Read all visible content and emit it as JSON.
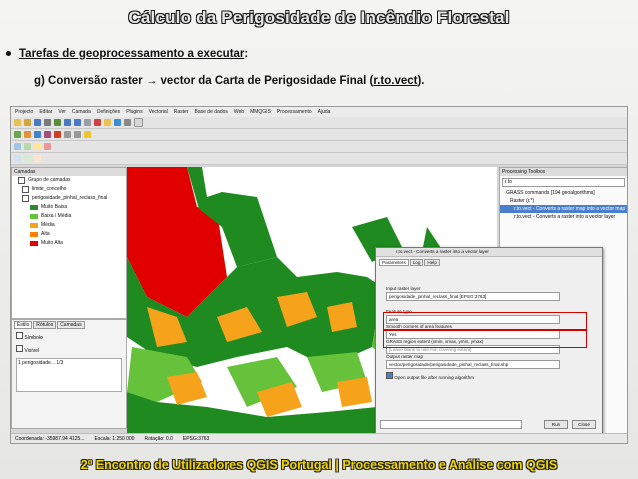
{
  "slide": {
    "title": "Cálculo da Perigosidade de Incêndio Florestal",
    "bullet": "Tarefas de geoprocessamento a executar",
    "bullet_suffix": ":",
    "sub_prefix": "g) Conversão raster → vector da Carta de Perigosidade Final (",
    "sub_link": "r.to.vect",
    "sub_suffix": ").",
    "footer": "2º Encontro de Utilizadores QGIS Portugal   |   Processamento e Análise com QGIS"
  },
  "qgis": {
    "menu": [
      "Projecto",
      "Editar",
      "Ver",
      "Camada",
      "Definições",
      "Plugins",
      "Vectorial",
      "Raster",
      "Base de dados",
      "Web",
      "MMQGIS",
      "Processamento",
      "Ajuda"
    ],
    "layers_panel": {
      "title": "Camadas",
      "items": [
        {
          "label": "Grupo de camadas",
          "checked": true
        },
        {
          "label": "limite_concelho",
          "checked": true
        },
        {
          "label": "perigosidade_pinhal_reclass_final",
          "checked": true
        }
      ],
      "legend": [
        {
          "label": "Muito Baixa",
          "color": "#2a8a2a"
        },
        {
          "label": "Baixa / Média",
          "color": "#66c23a"
        },
        {
          "label": "Média",
          "color": "#f7a21b"
        },
        {
          "label": "Alta",
          "color": "#ff7f00"
        },
        {
          "label": "Muito Alta",
          "color": "#e00000"
        }
      ]
    },
    "styler": {
      "tabs": [
        "Estilo",
        "Rótulos",
        "Camadas"
      ],
      "renderer": "Símbolo",
      "opacity_label": "Visível",
      "rows": [
        {
          "label": "1",
          "value": "perigosidade...",
          "extra": "1/3"
        }
      ]
    },
    "toolbox": {
      "title": "Processing Toolbox",
      "search_value": "r.to",
      "items": [
        {
          "label": "GRASS commands [194 geoalgorithms]",
          "selected": false
        },
        {
          "label": "Raster (r.*)",
          "selected": false
        },
        {
          "label": "r.to.vect - Converts a raster map into a vector map",
          "selected": true
        },
        {
          "label": "r.to.vect - Converts a raster into a vector layer",
          "selected": false
        }
      ]
    },
    "dialog": {
      "title": "r.to.vect - Converts a raster into a vector layer",
      "tabs": [
        "Parameters",
        "Log",
        "Help"
      ],
      "fields": [
        {
          "label": "Input raster layer",
          "value": "perigosidade_pinhal_reclass_final [EPSG:3763]"
        },
        {
          "label": "Feature type",
          "value": "area"
        },
        {
          "label": "Smooth corners of area features",
          "value": "Yes"
        },
        {
          "label": "GRASS region extent (xmin, xmax, ymin, ymax)",
          "value": "[Leave blank to use min covering extent]"
        },
        {
          "label": "Output raster map",
          "value": "vector/perigosidade/perigosidade_pinhal_reclass_final.shp"
        }
      ],
      "checkbox": "Open output file after running algorithm",
      "buttons": [
        "Run",
        "Close"
      ]
    },
    "status": {
      "coordinates": "Coordenada: -35987.94 4125...",
      "scale": "Escala: 1:250 000",
      "rotation": "Rotação: 0.0",
      "crs": "EPSG:3763"
    },
    "colors": {
      "very_low": "#1f8a1f",
      "low": "#66c23a",
      "medium": "#f7a21b",
      "high": "#e00000",
      "highlight": "#d40000"
    }
  }
}
